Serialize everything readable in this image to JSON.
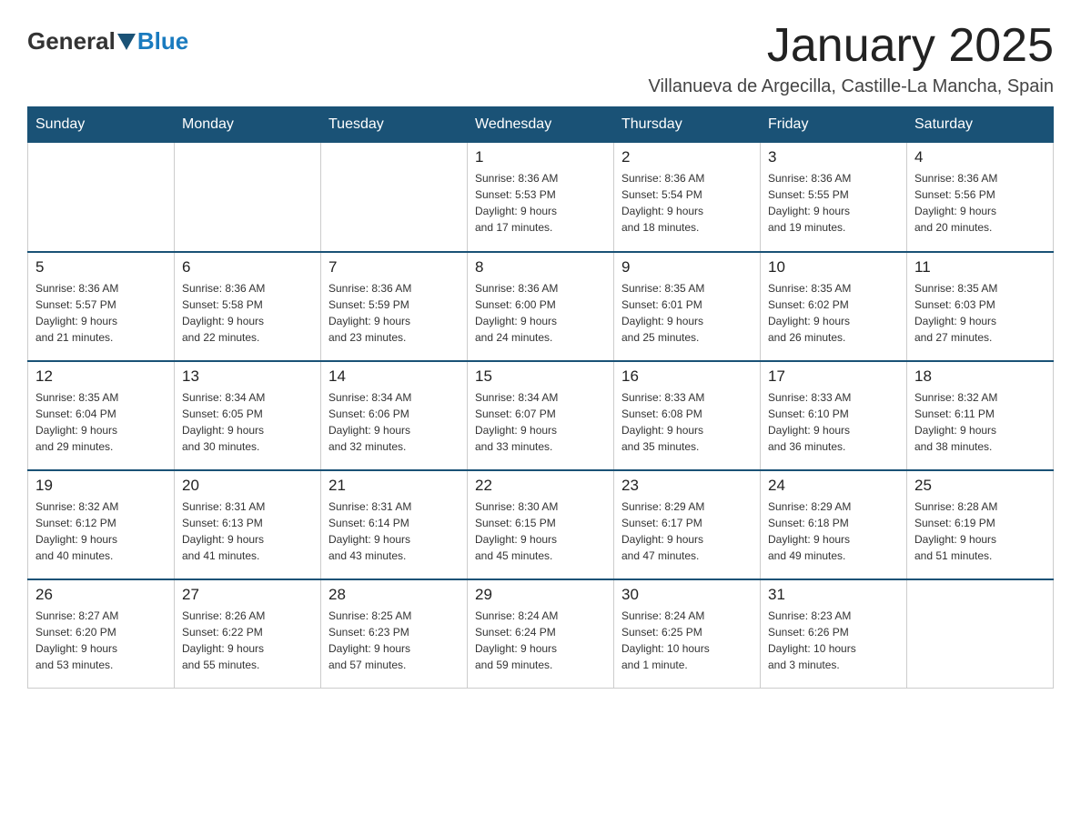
{
  "header": {
    "logo_text_general": "General",
    "logo_text_blue": "Blue",
    "month_title": "January 2025",
    "location": "Villanueva de Argecilla, Castille-La Mancha, Spain"
  },
  "weekdays": [
    "Sunday",
    "Monday",
    "Tuesday",
    "Wednesday",
    "Thursday",
    "Friday",
    "Saturday"
  ],
  "weeks": [
    [
      {
        "day": "",
        "info": ""
      },
      {
        "day": "",
        "info": ""
      },
      {
        "day": "",
        "info": ""
      },
      {
        "day": "1",
        "info": "Sunrise: 8:36 AM\nSunset: 5:53 PM\nDaylight: 9 hours\nand 17 minutes."
      },
      {
        "day": "2",
        "info": "Sunrise: 8:36 AM\nSunset: 5:54 PM\nDaylight: 9 hours\nand 18 minutes."
      },
      {
        "day": "3",
        "info": "Sunrise: 8:36 AM\nSunset: 5:55 PM\nDaylight: 9 hours\nand 19 minutes."
      },
      {
        "day": "4",
        "info": "Sunrise: 8:36 AM\nSunset: 5:56 PM\nDaylight: 9 hours\nand 20 minutes."
      }
    ],
    [
      {
        "day": "5",
        "info": "Sunrise: 8:36 AM\nSunset: 5:57 PM\nDaylight: 9 hours\nand 21 minutes."
      },
      {
        "day": "6",
        "info": "Sunrise: 8:36 AM\nSunset: 5:58 PM\nDaylight: 9 hours\nand 22 minutes."
      },
      {
        "day": "7",
        "info": "Sunrise: 8:36 AM\nSunset: 5:59 PM\nDaylight: 9 hours\nand 23 minutes."
      },
      {
        "day": "8",
        "info": "Sunrise: 8:36 AM\nSunset: 6:00 PM\nDaylight: 9 hours\nand 24 minutes."
      },
      {
        "day": "9",
        "info": "Sunrise: 8:35 AM\nSunset: 6:01 PM\nDaylight: 9 hours\nand 25 minutes."
      },
      {
        "day": "10",
        "info": "Sunrise: 8:35 AM\nSunset: 6:02 PM\nDaylight: 9 hours\nand 26 minutes."
      },
      {
        "day": "11",
        "info": "Sunrise: 8:35 AM\nSunset: 6:03 PM\nDaylight: 9 hours\nand 27 minutes."
      }
    ],
    [
      {
        "day": "12",
        "info": "Sunrise: 8:35 AM\nSunset: 6:04 PM\nDaylight: 9 hours\nand 29 minutes."
      },
      {
        "day": "13",
        "info": "Sunrise: 8:34 AM\nSunset: 6:05 PM\nDaylight: 9 hours\nand 30 minutes."
      },
      {
        "day": "14",
        "info": "Sunrise: 8:34 AM\nSunset: 6:06 PM\nDaylight: 9 hours\nand 32 minutes."
      },
      {
        "day": "15",
        "info": "Sunrise: 8:34 AM\nSunset: 6:07 PM\nDaylight: 9 hours\nand 33 minutes."
      },
      {
        "day": "16",
        "info": "Sunrise: 8:33 AM\nSunset: 6:08 PM\nDaylight: 9 hours\nand 35 minutes."
      },
      {
        "day": "17",
        "info": "Sunrise: 8:33 AM\nSunset: 6:10 PM\nDaylight: 9 hours\nand 36 minutes."
      },
      {
        "day": "18",
        "info": "Sunrise: 8:32 AM\nSunset: 6:11 PM\nDaylight: 9 hours\nand 38 minutes."
      }
    ],
    [
      {
        "day": "19",
        "info": "Sunrise: 8:32 AM\nSunset: 6:12 PM\nDaylight: 9 hours\nand 40 minutes."
      },
      {
        "day": "20",
        "info": "Sunrise: 8:31 AM\nSunset: 6:13 PM\nDaylight: 9 hours\nand 41 minutes."
      },
      {
        "day": "21",
        "info": "Sunrise: 8:31 AM\nSunset: 6:14 PM\nDaylight: 9 hours\nand 43 minutes."
      },
      {
        "day": "22",
        "info": "Sunrise: 8:30 AM\nSunset: 6:15 PM\nDaylight: 9 hours\nand 45 minutes."
      },
      {
        "day": "23",
        "info": "Sunrise: 8:29 AM\nSunset: 6:17 PM\nDaylight: 9 hours\nand 47 minutes."
      },
      {
        "day": "24",
        "info": "Sunrise: 8:29 AM\nSunset: 6:18 PM\nDaylight: 9 hours\nand 49 minutes."
      },
      {
        "day": "25",
        "info": "Sunrise: 8:28 AM\nSunset: 6:19 PM\nDaylight: 9 hours\nand 51 minutes."
      }
    ],
    [
      {
        "day": "26",
        "info": "Sunrise: 8:27 AM\nSunset: 6:20 PM\nDaylight: 9 hours\nand 53 minutes."
      },
      {
        "day": "27",
        "info": "Sunrise: 8:26 AM\nSunset: 6:22 PM\nDaylight: 9 hours\nand 55 minutes."
      },
      {
        "day": "28",
        "info": "Sunrise: 8:25 AM\nSunset: 6:23 PM\nDaylight: 9 hours\nand 57 minutes."
      },
      {
        "day": "29",
        "info": "Sunrise: 8:24 AM\nSunset: 6:24 PM\nDaylight: 9 hours\nand 59 minutes."
      },
      {
        "day": "30",
        "info": "Sunrise: 8:24 AM\nSunset: 6:25 PM\nDaylight: 10 hours\nand 1 minute."
      },
      {
        "day": "31",
        "info": "Sunrise: 8:23 AM\nSunset: 6:26 PM\nDaylight: 10 hours\nand 3 minutes."
      },
      {
        "day": "",
        "info": ""
      }
    ]
  ]
}
